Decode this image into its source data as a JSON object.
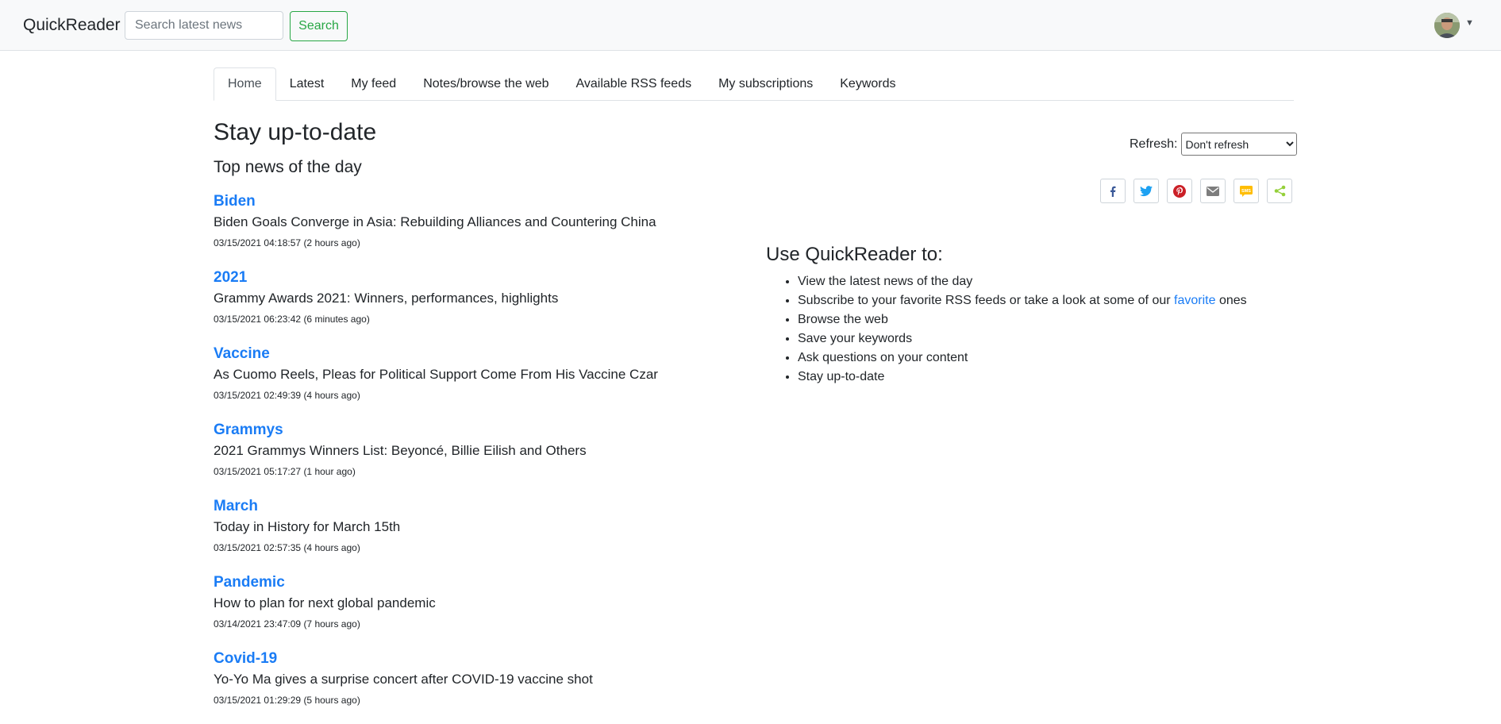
{
  "navbar": {
    "brand": "QuickReader",
    "search_placeholder": "Search latest news",
    "search_label": "Search"
  },
  "tabs": [
    {
      "label": "Home",
      "active": true
    },
    {
      "label": "Latest"
    },
    {
      "label": "My feed"
    },
    {
      "label": "Notes/browse the web"
    },
    {
      "label": "Available RSS feeds"
    },
    {
      "label": "My subscriptions"
    },
    {
      "label": "Keywords"
    }
  ],
  "main": {
    "title": "Stay up-to-date",
    "subtitle": "Top news of the day",
    "news": [
      {
        "keyword": "Biden",
        "headline": "Biden Goals Converge in Asia: Rebuilding Alliances and Countering China",
        "timestamp": "03/15/2021 04:18:57 (2 hours ago)"
      },
      {
        "keyword": "2021",
        "headline": "Grammy Awards 2021: Winners, performances, highlights",
        "timestamp": "03/15/2021 06:23:42 (6 minutes ago)"
      },
      {
        "keyword": "Vaccine",
        "headline": "As Cuomo Reels, Pleas for Political Support Come From His Vaccine Czar",
        "timestamp": "03/15/2021 02:49:39 (4 hours ago)"
      },
      {
        "keyword": "Grammys",
        "headline": "2021 Grammys Winners List: Beyoncé, Billie Eilish and Others",
        "timestamp": "03/15/2021 05:17:27 (1 hour ago)"
      },
      {
        "keyword": "March",
        "headline": "Today in History for March 15th",
        "timestamp": "03/15/2021 02:57:35 (4 hours ago)"
      },
      {
        "keyword": "Pandemic",
        "headline": "How to plan for next global pandemic",
        "timestamp": "03/14/2021 23:47:09 (7 hours ago)"
      },
      {
        "keyword": "Covid-19",
        "headline": "Yo-Yo Ma gives a surprise concert after COVID-19 vaccine shot",
        "timestamp": "03/15/2021 01:29:29 (5 hours ago)"
      }
    ]
  },
  "refresh": {
    "label": "Refresh:",
    "selected": "Don't refresh"
  },
  "share": [
    {
      "icon": "facebook-icon",
      "color": "#3b5998"
    },
    {
      "icon": "twitter-icon",
      "color": "#1da1f2"
    },
    {
      "icon": "pinterest-icon",
      "color": "#cb2027"
    },
    {
      "icon": "email-icon",
      "color": "#7d7d7d"
    },
    {
      "icon": "sms-icon",
      "color": "#ffbd00"
    },
    {
      "icon": "share-icon",
      "color": "#95d03a"
    }
  ],
  "use": {
    "title": "Use QuickReader to:",
    "items": {
      "0": "View the latest news of the day",
      "1_pre": "Subscribe to your favorite RSS feeds or take a look at some of our",
      "1_link": "favorite",
      "1_post": "ones",
      "2": "Browse the web",
      "3": "Save your keywords",
      "4": "Ask questions on your content",
      "5": "Stay up-to-date"
    }
  },
  "colors": {
    "link": "#1a7cf5",
    "search_button": "#28a745",
    "navbar_bg": "#f8f9fa"
  }
}
